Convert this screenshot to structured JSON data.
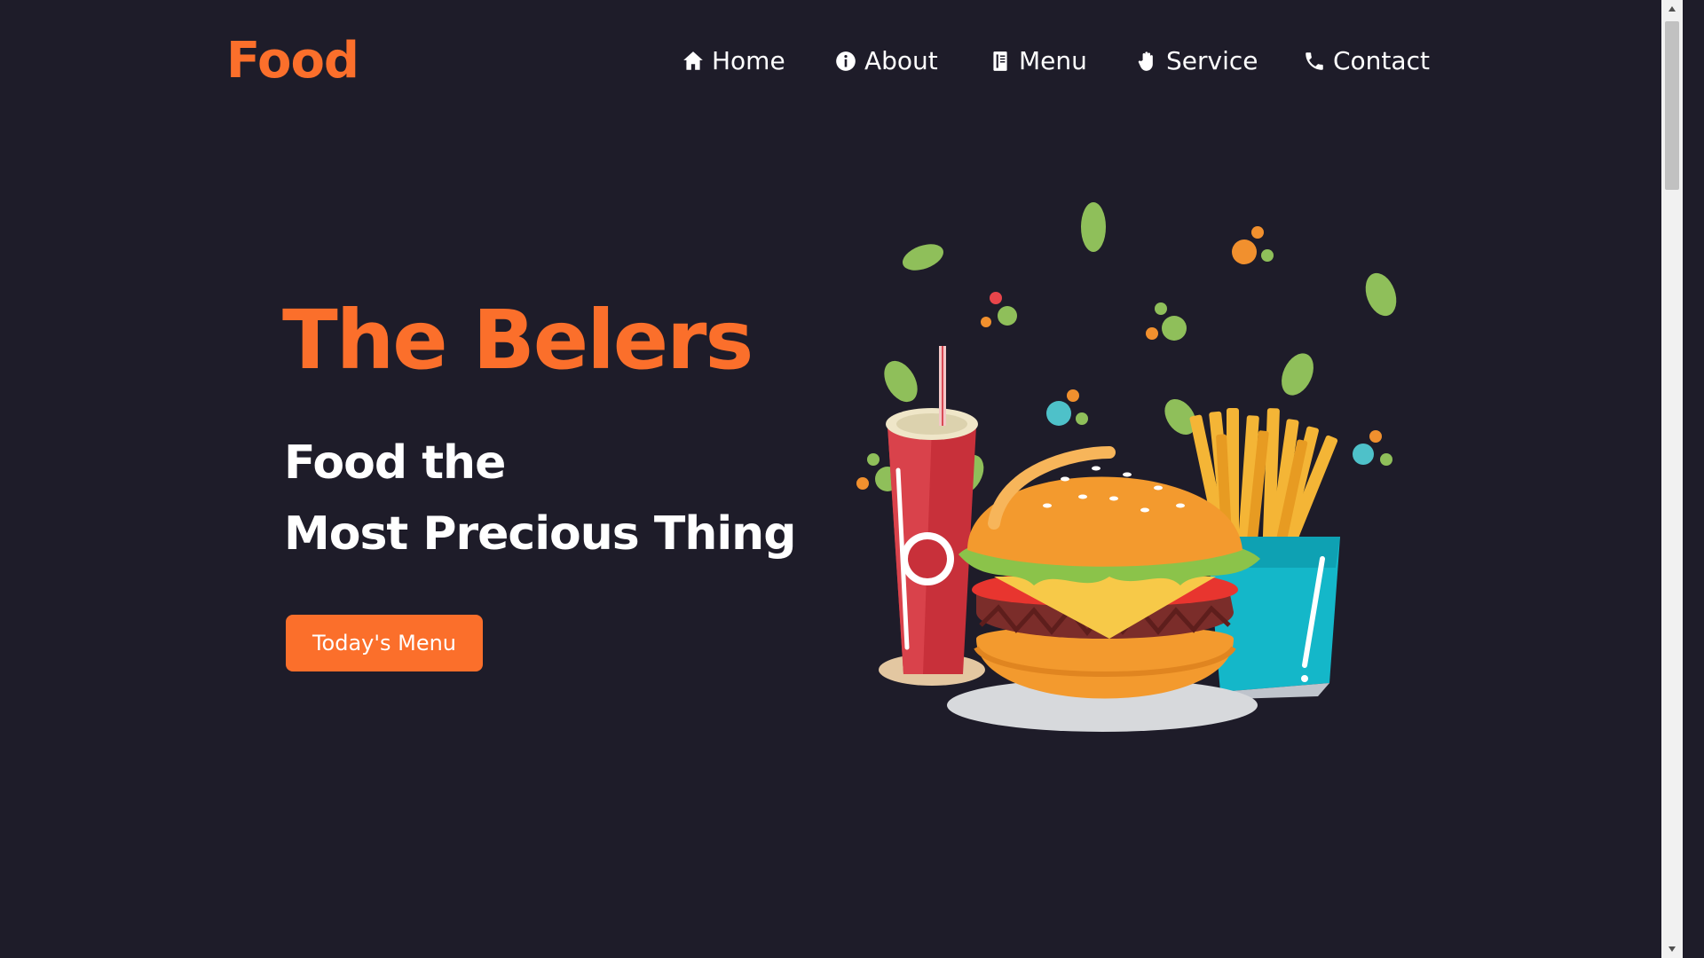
{
  "brand": {
    "logo_text": "Food",
    "accent_color": "#fb6f2b"
  },
  "nav": {
    "items": [
      {
        "label": "Home",
        "icon": "home-icon"
      },
      {
        "label": "About",
        "icon": "info-icon"
      },
      {
        "label": "Menu",
        "icon": "menu-book-icon"
      },
      {
        "label": "Service",
        "icon": "hand-icon"
      },
      {
        "label": "Contact",
        "icon": "phone-icon"
      }
    ]
  },
  "hero": {
    "title": "The Belers",
    "subtitle_line1": "Food the",
    "subtitle_line2": "Most Precious Thing",
    "cta_label": "Today's Menu"
  },
  "colors": {
    "background": "#1e1c29",
    "text": "#ffffff",
    "accent": "#fb6f2b"
  }
}
